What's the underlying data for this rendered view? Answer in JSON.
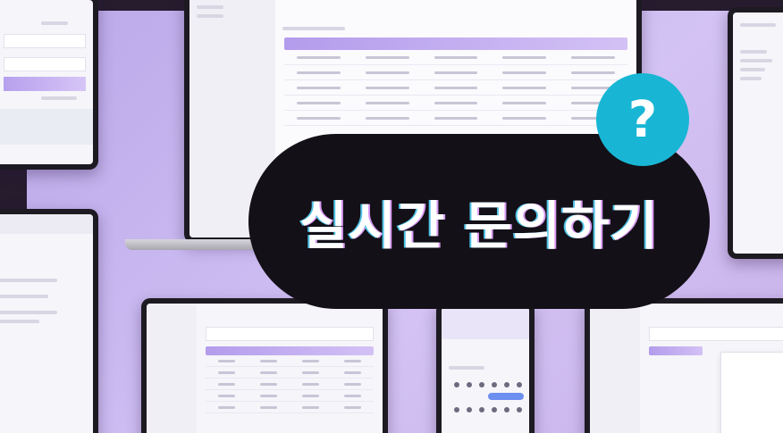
{
  "banner": {
    "headline": "실시간 문의하기",
    "badge_symbol": "?"
  },
  "colors": {
    "background_lavender": "#c8b7f0",
    "pill": "#131017",
    "badge": "#18b6d4",
    "table_header": "#b39cec"
  },
  "icons": [
    "question-mark-icon"
  ]
}
